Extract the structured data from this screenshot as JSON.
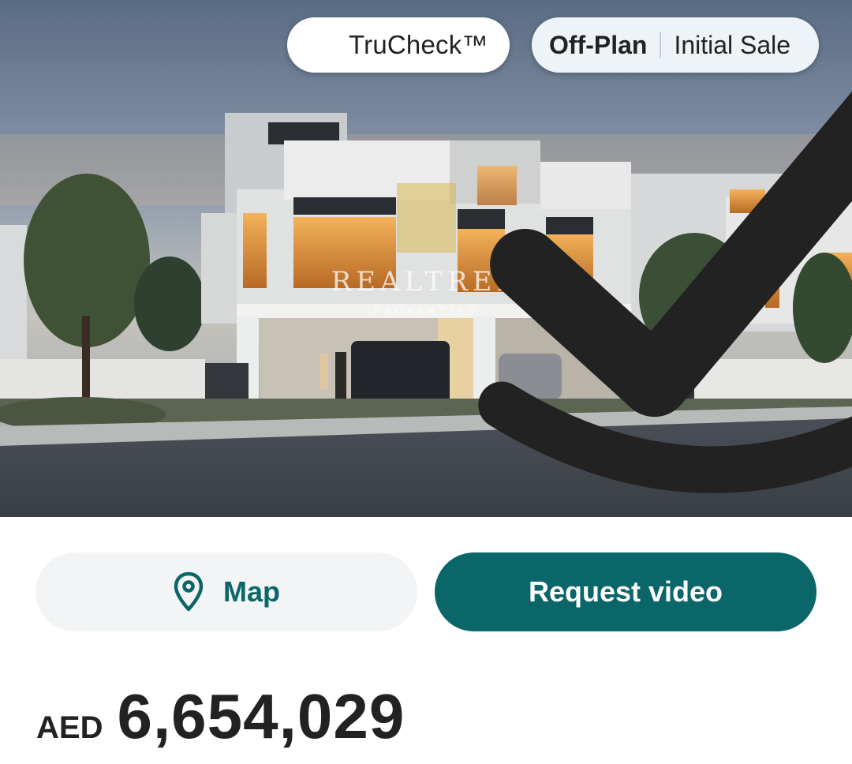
{
  "hero": {
    "image": "townhouse-rendering",
    "watermark": {
      "brand": "REALTREE",
      "sub": "PROPERTIES"
    },
    "badges": {
      "trucheck_label": "TruCheck™",
      "status_primary": "Off-Plan",
      "status_secondary": "Initial Sale"
    },
    "icons": {
      "trucheck": "checkmark-badge-icon"
    }
  },
  "actions": {
    "map_label": "Map",
    "map_icon": "location-pin-icon",
    "video_label": "Request video"
  },
  "price": {
    "currency": "AED",
    "amount": "6,654,029"
  },
  "colors": {
    "accent": "#0b6669",
    "map_button_bg": "#f3f4f5",
    "text": "#222222"
  }
}
